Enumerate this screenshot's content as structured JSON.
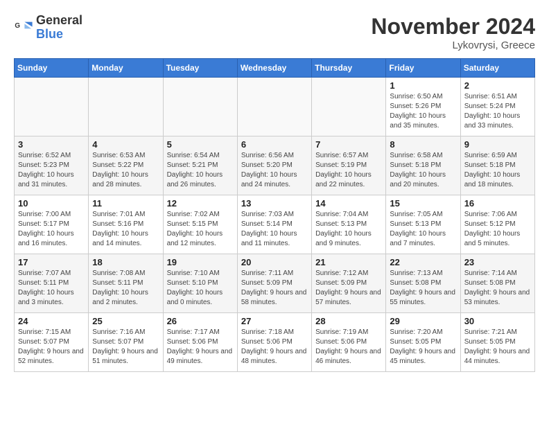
{
  "logo": {
    "general": "General",
    "blue": "Blue"
  },
  "header": {
    "month": "November 2024",
    "location": "Lykovrysi, Greece"
  },
  "weekdays": [
    "Sunday",
    "Monday",
    "Tuesday",
    "Wednesday",
    "Thursday",
    "Friday",
    "Saturday"
  ],
  "weeks": [
    [
      {
        "day": null
      },
      {
        "day": null
      },
      {
        "day": null
      },
      {
        "day": null
      },
      {
        "day": null
      },
      {
        "day": 1,
        "sunrise": "Sunrise: 6:50 AM",
        "sunset": "Sunset: 5:26 PM",
        "daylight": "Daylight: 10 hours and 35 minutes."
      },
      {
        "day": 2,
        "sunrise": "Sunrise: 6:51 AM",
        "sunset": "Sunset: 5:24 PM",
        "daylight": "Daylight: 10 hours and 33 minutes."
      }
    ],
    [
      {
        "day": 3,
        "sunrise": "Sunrise: 6:52 AM",
        "sunset": "Sunset: 5:23 PM",
        "daylight": "Daylight: 10 hours and 31 minutes."
      },
      {
        "day": 4,
        "sunrise": "Sunrise: 6:53 AM",
        "sunset": "Sunset: 5:22 PM",
        "daylight": "Daylight: 10 hours and 28 minutes."
      },
      {
        "day": 5,
        "sunrise": "Sunrise: 6:54 AM",
        "sunset": "Sunset: 5:21 PM",
        "daylight": "Daylight: 10 hours and 26 minutes."
      },
      {
        "day": 6,
        "sunrise": "Sunrise: 6:56 AM",
        "sunset": "Sunset: 5:20 PM",
        "daylight": "Daylight: 10 hours and 24 minutes."
      },
      {
        "day": 7,
        "sunrise": "Sunrise: 6:57 AM",
        "sunset": "Sunset: 5:19 PM",
        "daylight": "Daylight: 10 hours and 22 minutes."
      },
      {
        "day": 8,
        "sunrise": "Sunrise: 6:58 AM",
        "sunset": "Sunset: 5:18 PM",
        "daylight": "Daylight: 10 hours and 20 minutes."
      },
      {
        "day": 9,
        "sunrise": "Sunrise: 6:59 AM",
        "sunset": "Sunset: 5:18 PM",
        "daylight": "Daylight: 10 hours and 18 minutes."
      }
    ],
    [
      {
        "day": 10,
        "sunrise": "Sunrise: 7:00 AM",
        "sunset": "Sunset: 5:17 PM",
        "daylight": "Daylight: 10 hours and 16 minutes."
      },
      {
        "day": 11,
        "sunrise": "Sunrise: 7:01 AM",
        "sunset": "Sunset: 5:16 PM",
        "daylight": "Daylight: 10 hours and 14 minutes."
      },
      {
        "day": 12,
        "sunrise": "Sunrise: 7:02 AM",
        "sunset": "Sunset: 5:15 PM",
        "daylight": "Daylight: 10 hours and 12 minutes."
      },
      {
        "day": 13,
        "sunrise": "Sunrise: 7:03 AM",
        "sunset": "Sunset: 5:14 PM",
        "daylight": "Daylight: 10 hours and 11 minutes."
      },
      {
        "day": 14,
        "sunrise": "Sunrise: 7:04 AM",
        "sunset": "Sunset: 5:13 PM",
        "daylight": "Daylight: 10 hours and 9 minutes."
      },
      {
        "day": 15,
        "sunrise": "Sunrise: 7:05 AM",
        "sunset": "Sunset: 5:13 PM",
        "daylight": "Daylight: 10 hours and 7 minutes."
      },
      {
        "day": 16,
        "sunrise": "Sunrise: 7:06 AM",
        "sunset": "Sunset: 5:12 PM",
        "daylight": "Daylight: 10 hours and 5 minutes."
      }
    ],
    [
      {
        "day": 17,
        "sunrise": "Sunrise: 7:07 AM",
        "sunset": "Sunset: 5:11 PM",
        "daylight": "Daylight: 10 hours and 3 minutes."
      },
      {
        "day": 18,
        "sunrise": "Sunrise: 7:08 AM",
        "sunset": "Sunset: 5:11 PM",
        "daylight": "Daylight: 10 hours and 2 minutes."
      },
      {
        "day": 19,
        "sunrise": "Sunrise: 7:10 AM",
        "sunset": "Sunset: 5:10 PM",
        "daylight": "Daylight: 10 hours and 0 minutes."
      },
      {
        "day": 20,
        "sunrise": "Sunrise: 7:11 AM",
        "sunset": "Sunset: 5:09 PM",
        "daylight": "Daylight: 9 hours and 58 minutes."
      },
      {
        "day": 21,
        "sunrise": "Sunrise: 7:12 AM",
        "sunset": "Sunset: 5:09 PM",
        "daylight": "Daylight: 9 hours and 57 minutes."
      },
      {
        "day": 22,
        "sunrise": "Sunrise: 7:13 AM",
        "sunset": "Sunset: 5:08 PM",
        "daylight": "Daylight: 9 hours and 55 minutes."
      },
      {
        "day": 23,
        "sunrise": "Sunrise: 7:14 AM",
        "sunset": "Sunset: 5:08 PM",
        "daylight": "Daylight: 9 hours and 53 minutes."
      }
    ],
    [
      {
        "day": 24,
        "sunrise": "Sunrise: 7:15 AM",
        "sunset": "Sunset: 5:07 PM",
        "daylight": "Daylight: 9 hours and 52 minutes."
      },
      {
        "day": 25,
        "sunrise": "Sunrise: 7:16 AM",
        "sunset": "Sunset: 5:07 PM",
        "daylight": "Daylight: 9 hours and 51 minutes."
      },
      {
        "day": 26,
        "sunrise": "Sunrise: 7:17 AM",
        "sunset": "Sunset: 5:06 PM",
        "daylight": "Daylight: 9 hours and 49 minutes."
      },
      {
        "day": 27,
        "sunrise": "Sunrise: 7:18 AM",
        "sunset": "Sunset: 5:06 PM",
        "daylight": "Daylight: 9 hours and 48 minutes."
      },
      {
        "day": 28,
        "sunrise": "Sunrise: 7:19 AM",
        "sunset": "Sunset: 5:06 PM",
        "daylight": "Daylight: 9 hours and 46 minutes."
      },
      {
        "day": 29,
        "sunrise": "Sunrise: 7:20 AM",
        "sunset": "Sunset: 5:05 PM",
        "daylight": "Daylight: 9 hours and 45 minutes."
      },
      {
        "day": 30,
        "sunrise": "Sunrise: 7:21 AM",
        "sunset": "Sunset: 5:05 PM",
        "daylight": "Daylight: 9 hours and 44 minutes."
      }
    ]
  ]
}
